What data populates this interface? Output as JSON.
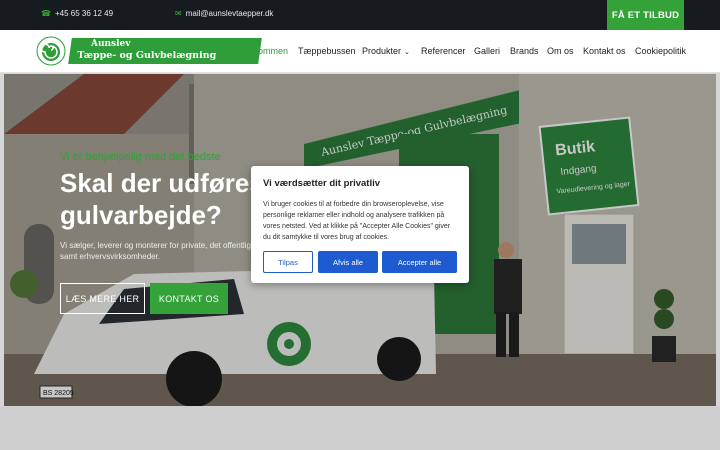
{
  "topbar": {
    "phone": "+45 65 36 12 49",
    "email": "mail@aunslevtaepper.dk",
    "cta": "FÅ ET TILBUD"
  },
  "logo": {
    "line1": "Aunslev",
    "line2": "Tæppe- og Gulvbelægning"
  },
  "nav": {
    "items": [
      "Velkommen",
      "Tæppebussen",
      "Produkter",
      "Referencer",
      "Galleri",
      "Brands",
      "Om os",
      "Kontakt os",
      "Cookiepolitik"
    ],
    "active": "Velkommen"
  },
  "hero": {
    "subtitle": "Vi er behjælpelig med det bedste",
    "title": "Skal der udføres tæppe- og gulvarbejde?",
    "paragraph": "Vi sælger, leverer og monterer for private, det offentlige, sygehuse, institutioner mv.) samt erhvervsvirksomheder.",
    "btn_more": "LÆS MERE HER",
    "btn_contact": "KONTAKT OS"
  },
  "photo": {
    "building_sign": "Aunslev Tæppe-og Gulvbelægning",
    "shop_sign_title": "Butik",
    "shop_sign_sub": "Indgang",
    "shop_sign_extra": "Vareudlevering og lager",
    "plate": "BS 28205"
  },
  "cookie": {
    "title": "Vi værdsætter dit privatliv",
    "body": "Vi bruger cookies til at forbedre din browseroplevelse, vise personlige reklamer eller indhold og analysere trafikken på vores netsted. Ved at klikke på \"Accepter Alle Cookies\" giver du dit samtykke til vores brug af cookies.",
    "btn_customize": "Tilpas",
    "btn_reject": "Afvis alle",
    "btn_accept": "Accepter alle"
  },
  "colors": {
    "brand_green": "#34a139",
    "topbar_bg": "#161b1f",
    "cookie_blue": "#1f5bd0"
  }
}
